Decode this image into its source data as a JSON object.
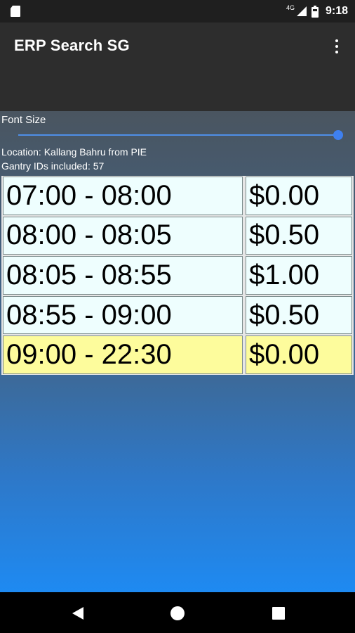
{
  "status_bar": {
    "network": "4G",
    "time": "9:18",
    "icons": [
      "sd-card-icon",
      "signal-icon",
      "battery-icon"
    ]
  },
  "app_bar": {
    "title": "ERP Search SG",
    "menu_icon": "overflow-menu-icon"
  },
  "font_size": {
    "label": "Font Size",
    "value_fraction": 1.0
  },
  "info": {
    "location": "Location: Kallang Bahru from PIE",
    "gantry": "Gantry IDs included: 57"
  },
  "rates": [
    {
      "time": "07:00 - 08:00",
      "price": "$0.00",
      "current": false
    },
    {
      "time": "08:00 - 08:05",
      "price": "$0.50",
      "current": false
    },
    {
      "time": "08:05 - 08:55",
      "price": "$1.00",
      "current": false
    },
    {
      "time": "08:55 - 09:00",
      "price": "$0.50",
      "current": false
    },
    {
      "time": "09:00 - 22:30",
      "price": "$0.00",
      "current": true
    }
  ],
  "colors": {
    "highlight_row": "#fdfc9c",
    "row_background": "#eefefe",
    "accent": "#3f80f0"
  },
  "nav_bar": {
    "icons": [
      "back-icon",
      "home-icon",
      "recents-icon"
    ]
  }
}
